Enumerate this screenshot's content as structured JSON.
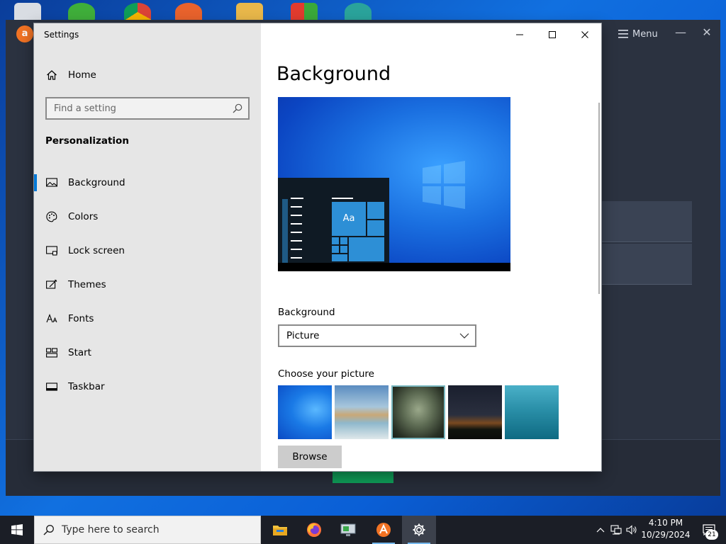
{
  "background_app": {
    "menu_label": "Menu"
  },
  "window": {
    "title": "Settings"
  },
  "sidebar": {
    "home_label": "Home",
    "search_placeholder": "Find a setting",
    "section_title": "Personalization",
    "items": [
      {
        "label": "Background",
        "icon": "picture-icon",
        "active": true
      },
      {
        "label": "Colors",
        "icon": "palette-icon",
        "active": false
      },
      {
        "label": "Lock screen",
        "icon": "lock-screen-icon",
        "active": false
      },
      {
        "label": "Themes",
        "icon": "themes-icon",
        "active": false
      },
      {
        "label": "Fonts",
        "icon": "fonts-icon",
        "active": false
      },
      {
        "label": "Start",
        "icon": "start-icon",
        "active": false
      },
      {
        "label": "Taskbar",
        "icon": "taskbar-icon",
        "active": false
      }
    ]
  },
  "main": {
    "title": "Background",
    "preview_tile_text": "Aa",
    "background_label": "Background",
    "background_value": "Picture",
    "choose_label": "Choose your picture",
    "browse_label": "Browse"
  },
  "taskbar": {
    "search_placeholder": "Type here to search",
    "time": "4:10 PM",
    "date": "10/29/2024",
    "notification_count": "21"
  },
  "colors": {
    "accent": "#0078d7",
    "sidebar_bg": "#e6e6e6",
    "taskbar_bg": "#1b1e26",
    "bgapp_bg": "#2b3240"
  }
}
